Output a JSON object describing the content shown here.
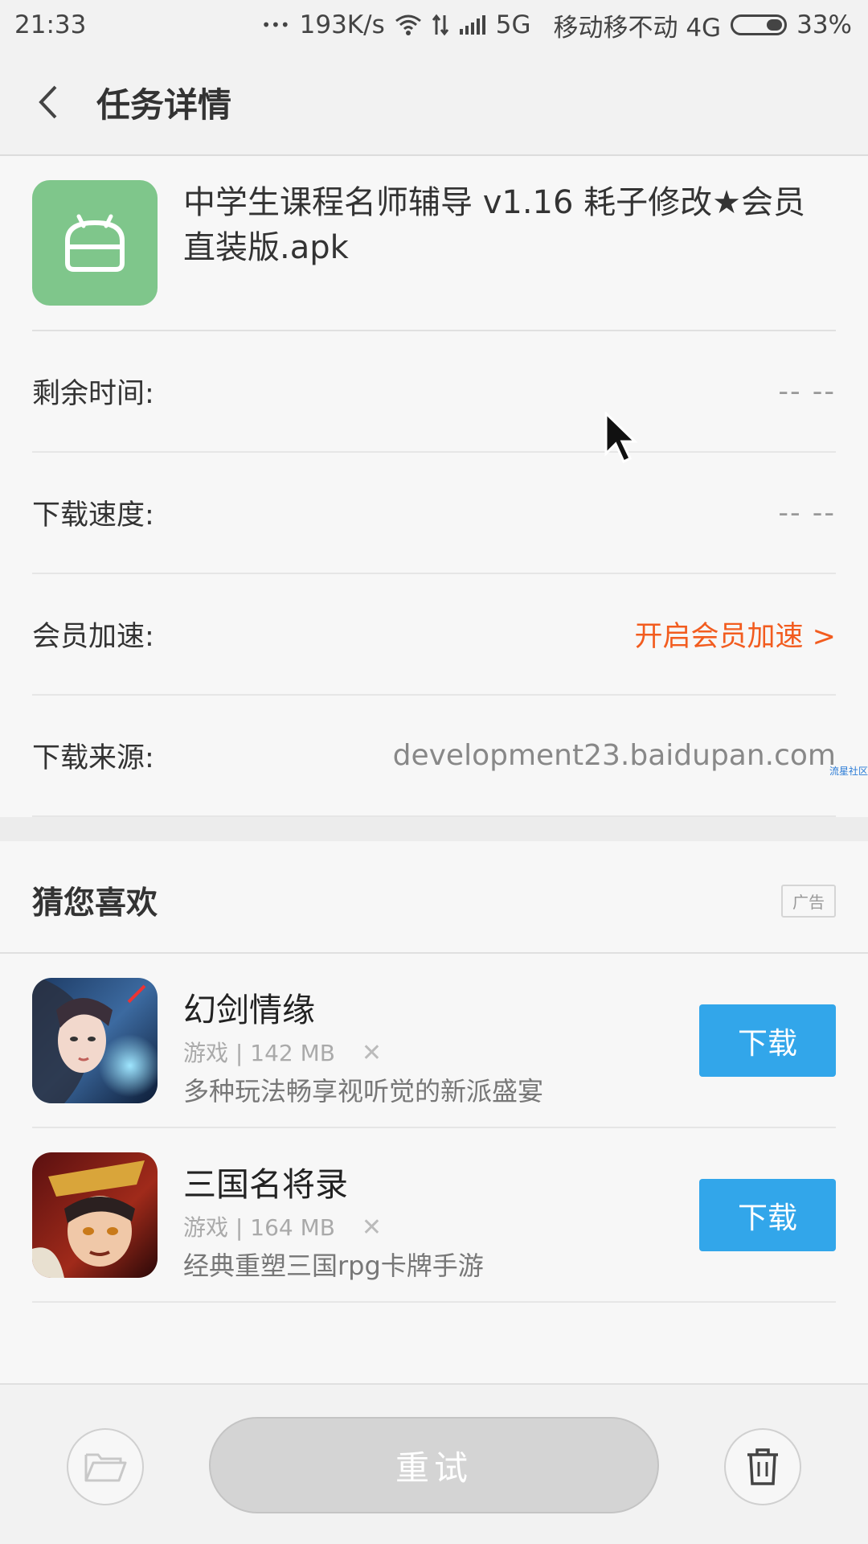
{
  "status_bar": {
    "time": "21:33",
    "dots": "•••",
    "speed": "193K/s",
    "network": "5G",
    "carrier": "移动移不动 4G",
    "battery_percent": "33%",
    "battery_level": 0.33
  },
  "header": {
    "back_icon": "chevron-left-icon",
    "title": "任务详情"
  },
  "file": {
    "icon": "android-icon",
    "icon_color": "#7fc68b",
    "name": "中学生课程名师辅导 v1.16 耗子修改★会员直装版.apk"
  },
  "details": [
    {
      "label": "剩余时间:",
      "value": "-- --"
    },
    {
      "label": "下载速度:",
      "value": "-- --"
    },
    {
      "label": "会员加速:",
      "value": "开启会员加速 >"
    },
    {
      "label": "下载来源:",
      "value": "development23.baidupan.com"
    }
  ],
  "watermark": "流星社区",
  "recommend": {
    "title": "猜您喜欢",
    "ad_label": "广告",
    "apps": [
      {
        "name": "幻剑情缘",
        "category": "游戏",
        "size": "142 MB",
        "close": "✕",
        "description": "多种玩法畅享视听觉的新派盛宴",
        "button": "下载"
      },
      {
        "name": "三国名将录",
        "category": "游戏",
        "size": "164 MB",
        "close": "✕",
        "description": "经典重塑三国rpg卡牌手游",
        "button": "下载"
      }
    ]
  },
  "bottom_bar": {
    "folder_icon": "folder-icon",
    "retry_label": "重试",
    "delete_icon": "trash-icon"
  },
  "colors": {
    "accent_orange": "#f25c1f",
    "download_blue": "#32a6ea",
    "apk_green": "#7fc68b"
  }
}
